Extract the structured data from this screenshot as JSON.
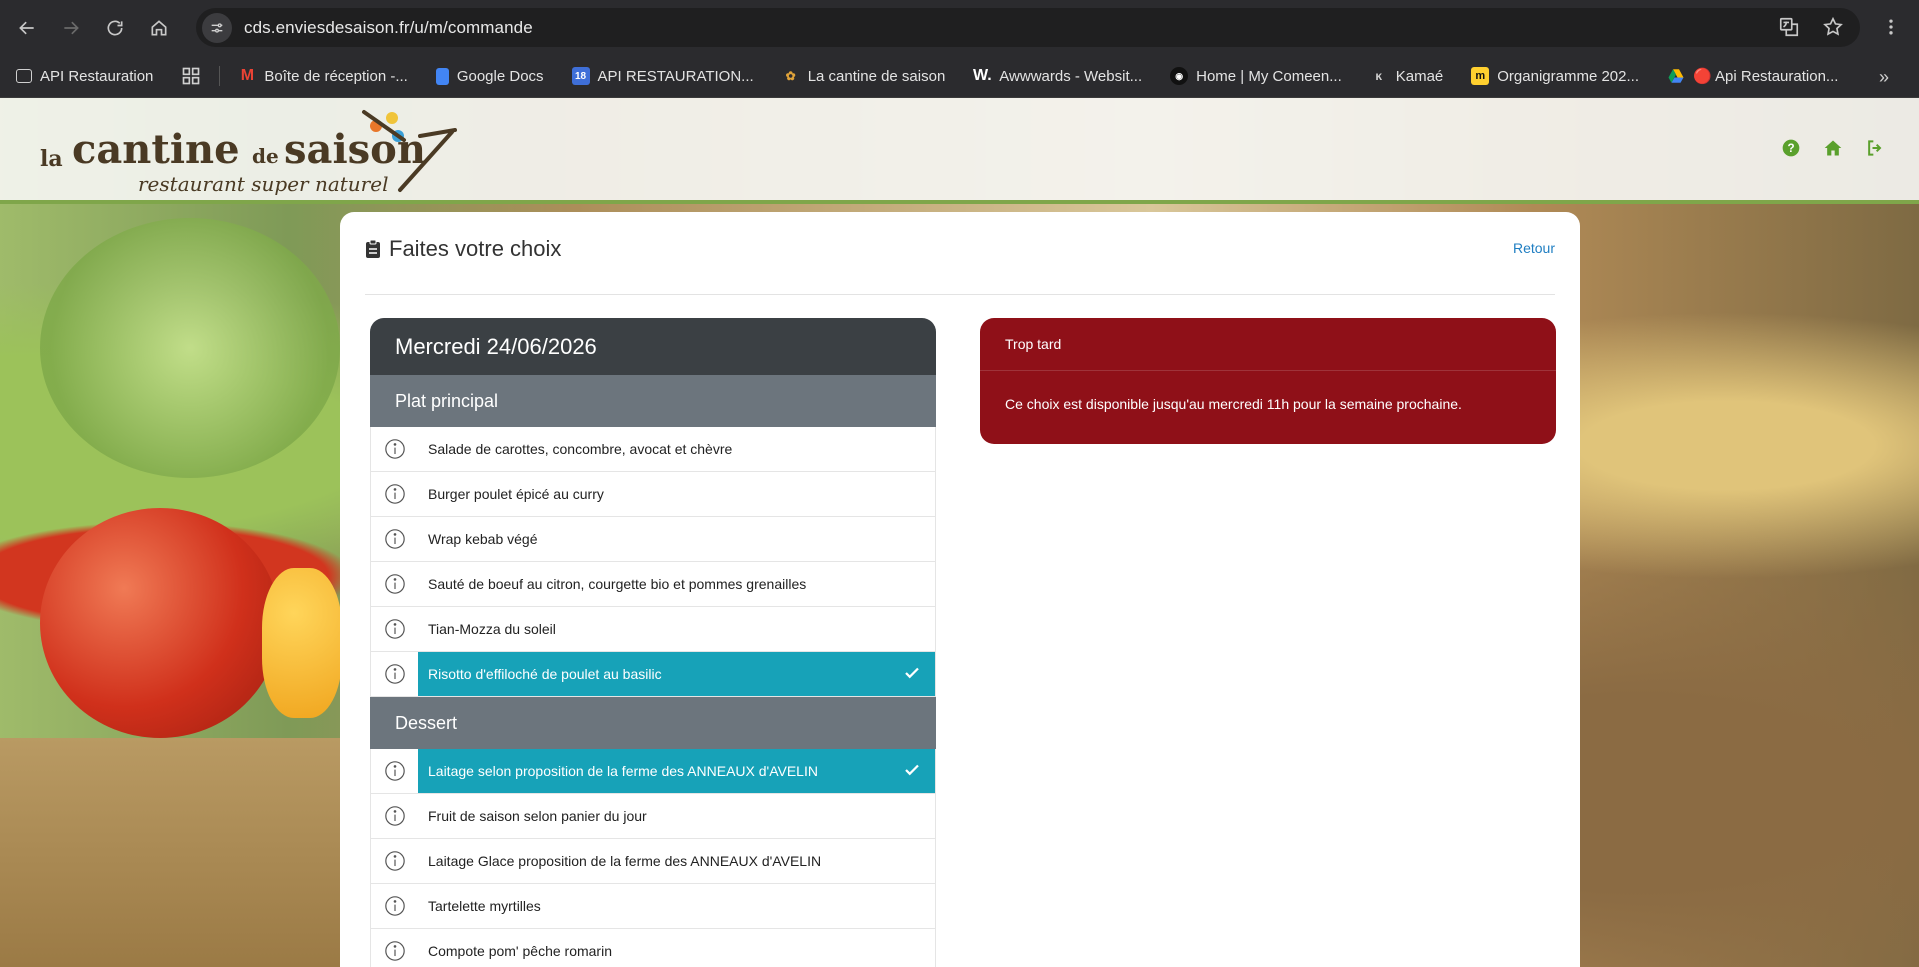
{
  "browser": {
    "url": "cds.enviesdesaison.fr/u/m/commande",
    "bookmarks": [
      {
        "label": "API Restauration",
        "icon": "folder-link-icon"
      },
      {
        "label": "Boîte de réception -...",
        "icon": "gmail-icon"
      },
      {
        "label": "Google Docs",
        "icon": "docs-icon"
      },
      {
        "label": "API RESTAURATION...",
        "icon": "calendar-icon"
      },
      {
        "label": "La cantine de saison",
        "icon": "cantine-icon"
      },
      {
        "label": "Awwwards - Websit...",
        "icon": "awwwards-icon"
      },
      {
        "label": "Home | My Comeen...",
        "icon": "comeen-icon"
      },
      {
        "label": "Kamaé",
        "icon": "kamae-icon"
      },
      {
        "label": "Organigramme 202...",
        "icon": "miro-icon"
      },
      {
        "label": "🔴 Api Restauration...",
        "icon": "drive-icon"
      }
    ]
  },
  "logo": {
    "la": "la",
    "cantine": "cantine",
    "de": "de",
    "saison": "saison",
    "tagline": "restaurant super naturel"
  },
  "page": {
    "title": "Faites votre choix",
    "back_label": "Retour",
    "day": "Mercredi 24/06/2026",
    "sections": [
      {
        "name": "Plat principal",
        "items": [
          {
            "label": "Salade de carottes, concombre, avocat et chèvre",
            "selected": false
          },
          {
            "label": "Burger poulet épicé au curry",
            "selected": false
          },
          {
            "label": "Wrap kebab végé",
            "selected": false
          },
          {
            "label": "Sauté de boeuf au citron, courgette bio et pommes grenailles",
            "selected": false
          },
          {
            "label": "Tian-Mozza du soleil",
            "selected": false
          },
          {
            "label": "Risotto d'effiloché de poulet au basilic",
            "selected": true
          }
        ]
      },
      {
        "name": "Dessert",
        "items": [
          {
            "label": "Laitage selon proposition de la ferme des ANNEAUX d'AVELIN",
            "selected": true
          },
          {
            "label": "Fruit de saison selon panier du jour",
            "selected": false
          },
          {
            "label": "Laitage Glace proposition de la ferme des ANNEAUX d'AVELIN",
            "selected": false
          },
          {
            "label": "Tartelette myrtilles",
            "selected": false
          },
          {
            "label": "Compote pom' pêche romarin",
            "selected": false
          }
        ]
      }
    ],
    "alert": {
      "title": "Trop tard",
      "message": "Ce choix est disponible jusqu'au mercredi 11h pour la semaine prochaine."
    }
  },
  "colors": {
    "selected": "#17a2b8",
    "alert": "#8f1018",
    "header_icons": "#5aa02c",
    "link": "#1f7ec2"
  }
}
